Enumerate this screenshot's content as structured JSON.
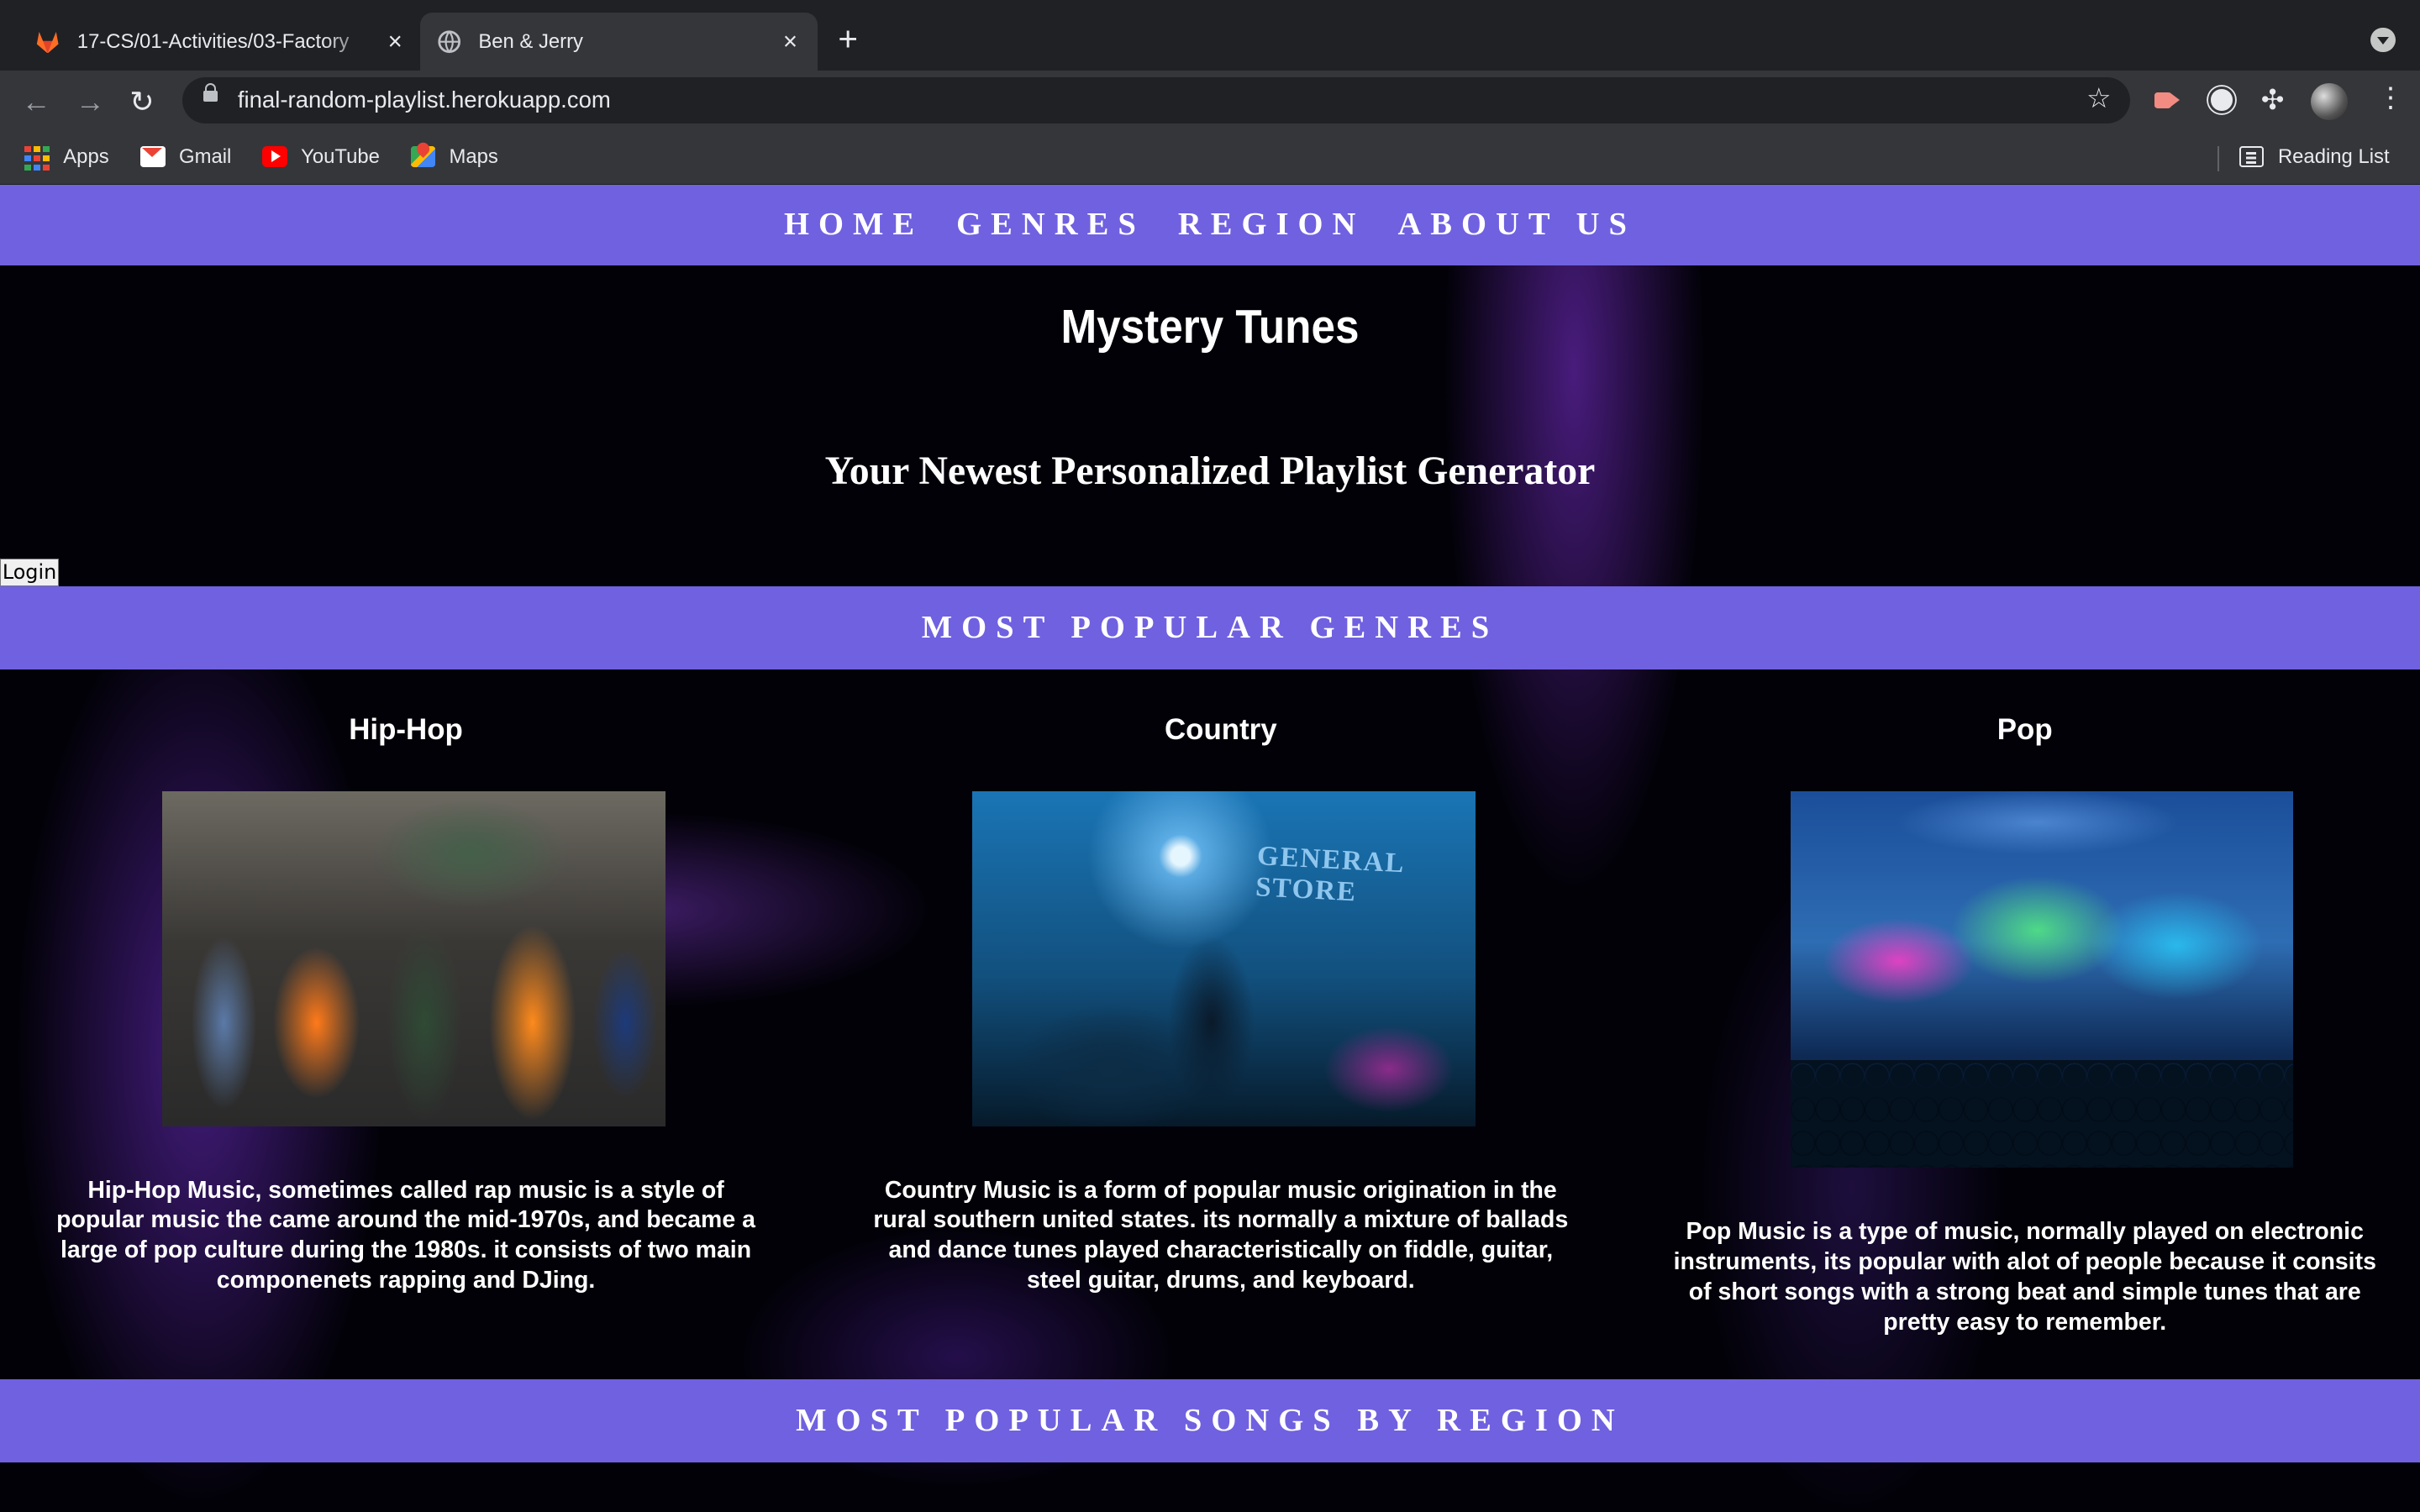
{
  "browser": {
    "tabs": [
      {
        "title": "17-CS/01-Activities/03-Factory",
        "icon": "gitlab-icon"
      },
      {
        "title": "Ben & Jerry",
        "icon": "globe-icon"
      }
    ],
    "url": "final-random-playlist.herokuapp.com",
    "bookmarks": [
      {
        "label": "Apps",
        "icon": "apps-icon"
      },
      {
        "label": "Gmail",
        "icon": "gmail-icon"
      },
      {
        "label": "YouTube",
        "icon": "youtube-icon"
      },
      {
        "label": "Maps",
        "icon": "maps-icon"
      }
    ],
    "reading_list": "Reading List"
  },
  "nav": {
    "links": [
      "HOME",
      "GENRES",
      "REGION",
      "ABOUT US"
    ]
  },
  "hero": {
    "title": "Mystery Tunes",
    "subtitle": "Your Newest Personalized Playlist Generator",
    "login": "Login"
  },
  "sections": {
    "genres_heading": "MOST POPULAR GENRES",
    "region_heading": "MOST POPULAR SONGS BY REGION"
  },
  "genres": [
    {
      "name": "Hip-Hop",
      "description": "Hip-Hop Music, sometimes called rap music is a style of popular music the came around the mid-1970s, and became a large of pop culture during the 1980s. it consists of two main componenets rapping and DJing."
    },
    {
      "name": "Country",
      "description": "Country Music is a form of popular music origination in the rural southern united states. its normally a mixture of ballads and dance tunes played characteristically on fiddle, guitar, steel guitar, drums, and keyboard.",
      "image_sign": "GENERAL STORE"
    },
    {
      "name": "Pop",
      "description": "Pop Music is a type of music, normally played on electronic instruments, its popular with alot of people because it consits of short songs with a strong beat and simple tunes that are pretty easy to remember."
    }
  ],
  "colors": {
    "band": "#7061e0",
    "page_bg": "#020108",
    "chrome_dark": "#202124",
    "chrome_mid": "#35363a"
  }
}
